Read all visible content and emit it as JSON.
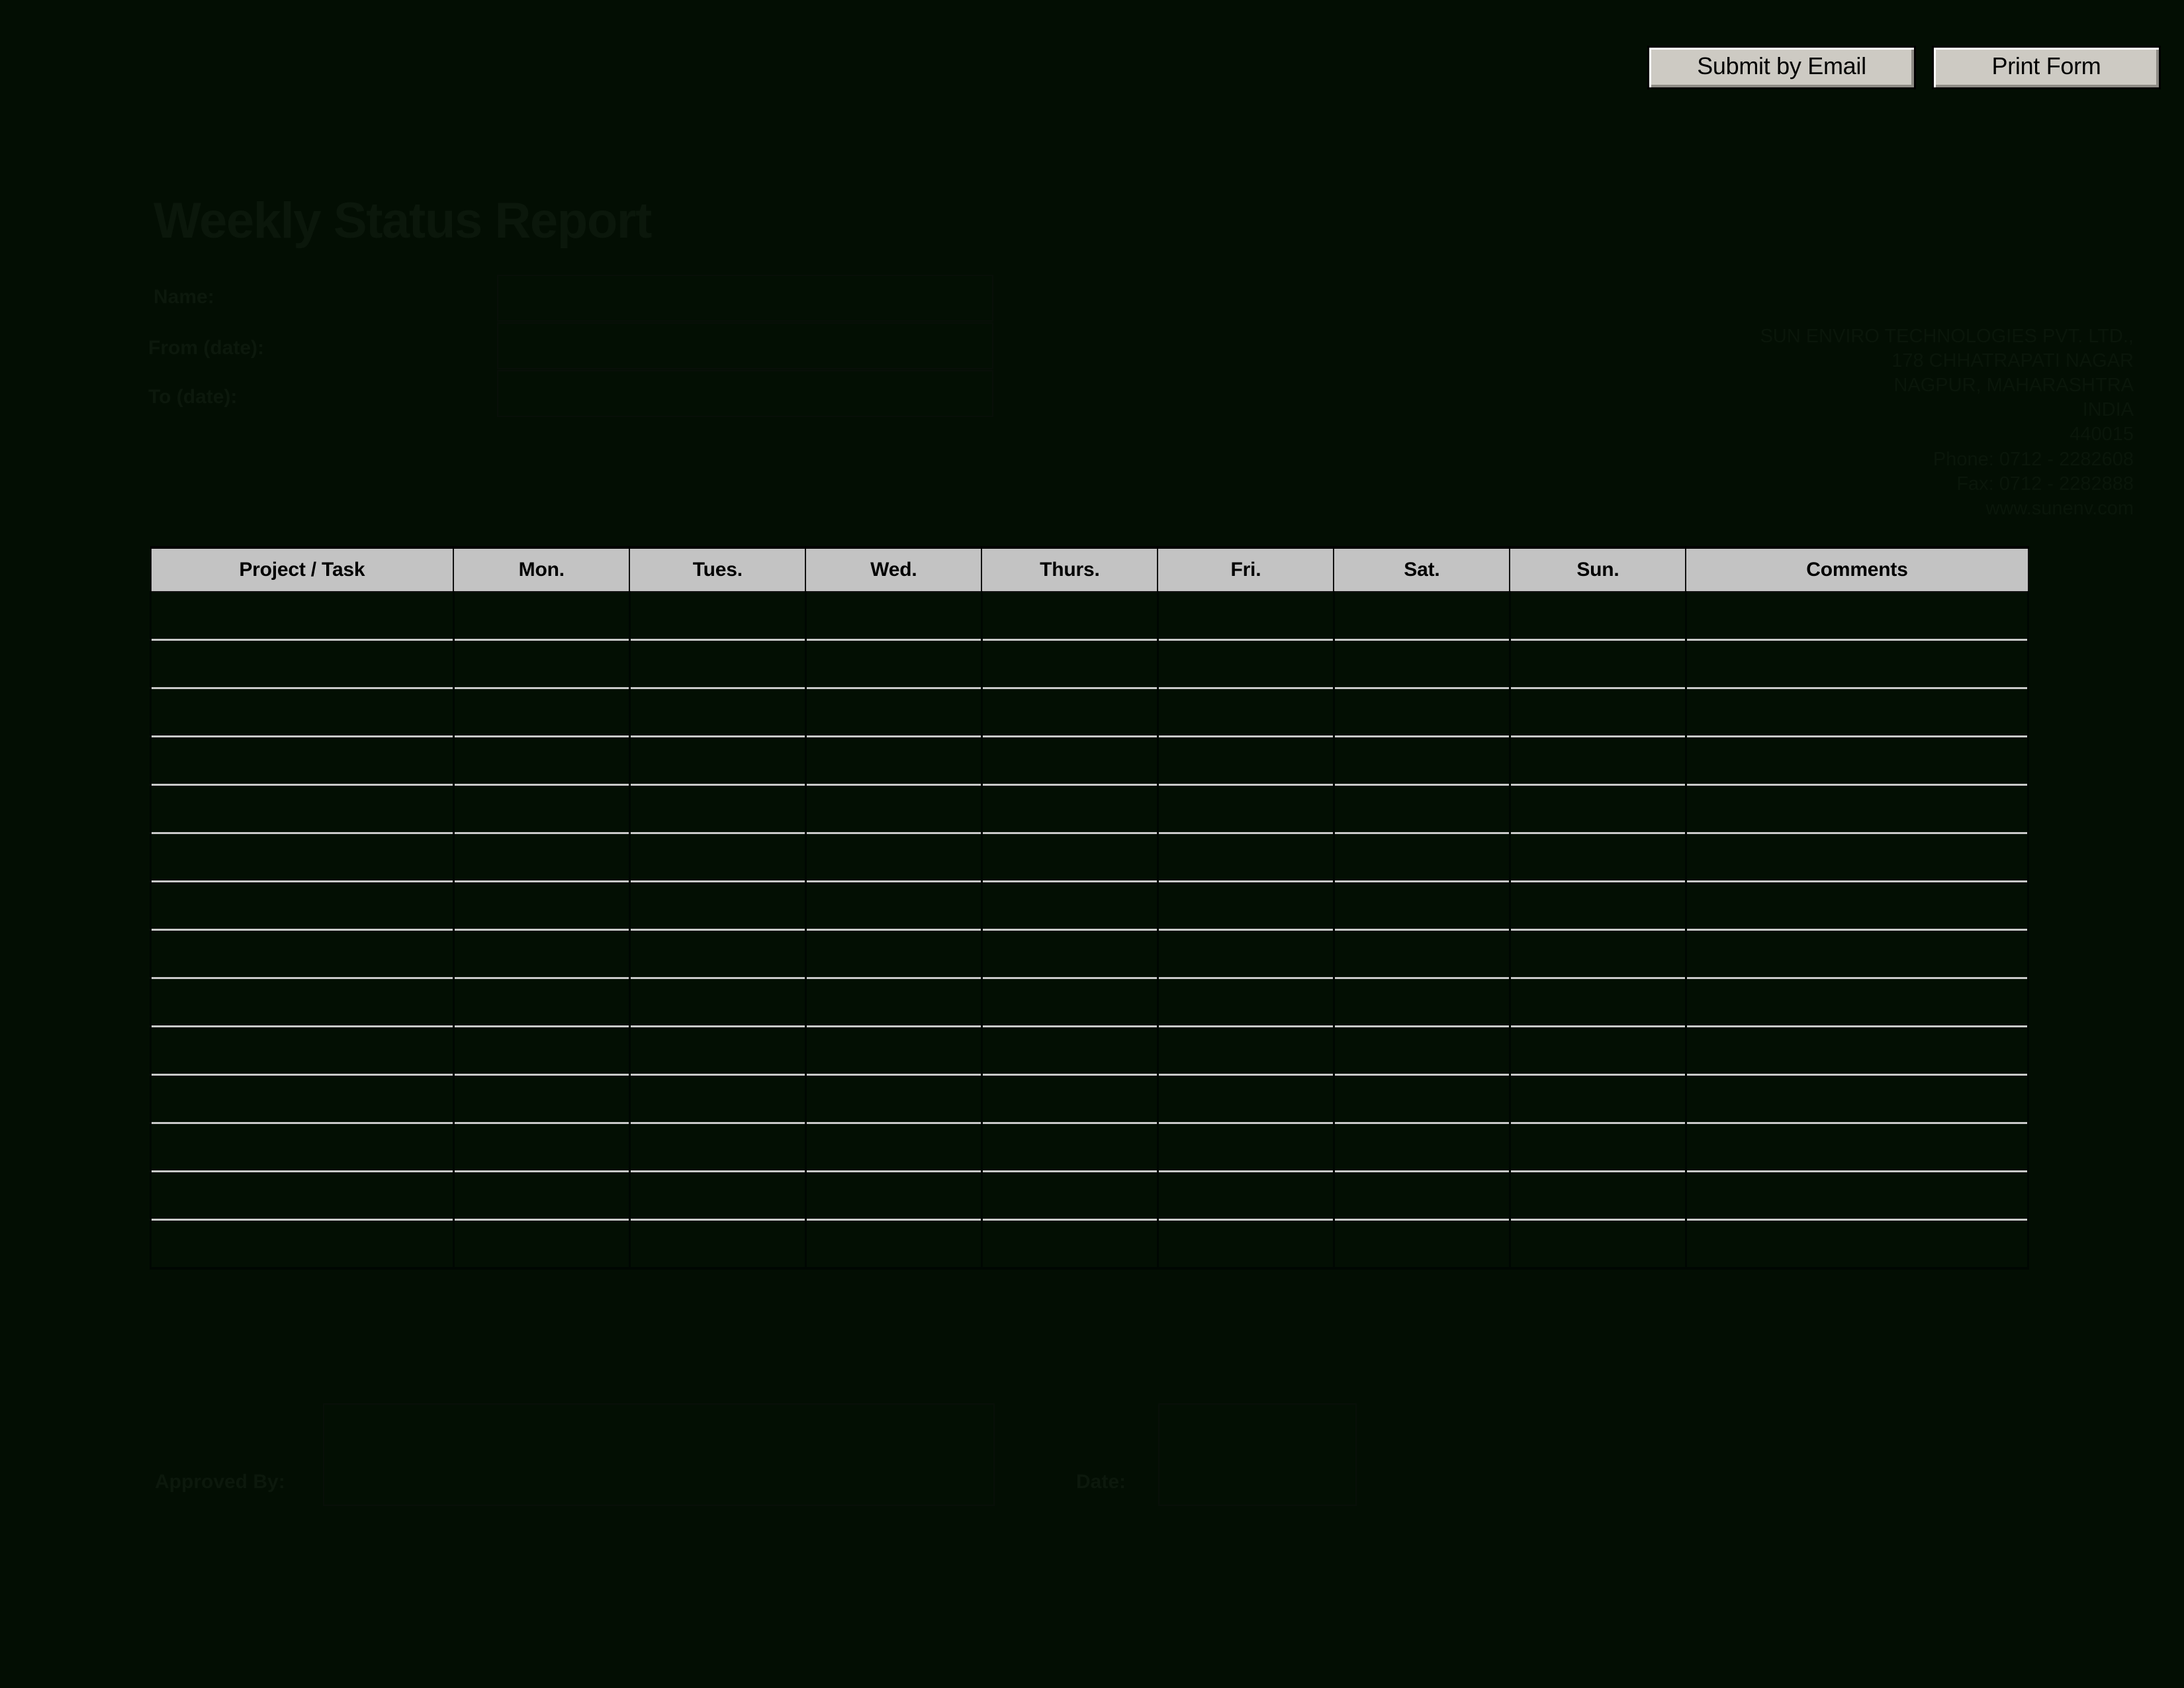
{
  "toolbar": {
    "submit_by_email_label": "Submit by Email",
    "print_form_label": "Print Form"
  },
  "document": {
    "title": "Weekly Status Report"
  },
  "form_fields": {
    "name_label": "Name:",
    "name_value": "",
    "name_placeholder": "",
    "from_date_label": "From (date):",
    "from_date_value": "",
    "from_date_placeholder": "",
    "to_date_label": "To (date):",
    "to_date_value": "",
    "to_date_placeholder": ""
  },
  "company": {
    "address_lines": [
      "SUN ENVIRO TECHNOLOGIES PVT. LTD.,",
      "178 CHHATRAPATI NAGAR",
      "NAGPUR, MAHARASHTRA",
      "INDIA",
      "440015",
      "Phone: 0712 - 2282608",
      "Fax: 0712 - 2282888",
      "www.sunenv.com"
    ]
  },
  "table": {
    "headers": [
      "Project / Task",
      "Mon.",
      "Tues.",
      "Wed.",
      "Thurs.",
      "Fri.",
      "Sat.",
      "Sun.",
      "Comments"
    ],
    "row_count": 14,
    "rows": [
      [
        "",
        "",
        "",
        "",
        "",
        "",
        "",
        "",
        ""
      ],
      [
        "",
        "",
        "",
        "",
        "",
        "",
        "",
        "",
        ""
      ],
      [
        "",
        "",
        "",
        "",
        "",
        "",
        "",
        "",
        ""
      ],
      [
        "",
        "",
        "",
        "",
        "",
        "",
        "",
        "",
        ""
      ],
      [
        "",
        "",
        "",
        "",
        "",
        "",
        "",
        "",
        ""
      ],
      [
        "",
        "",
        "",
        "",
        "",
        "",
        "",
        "",
        ""
      ],
      [
        "",
        "",
        "",
        "",
        "",
        "",
        "",
        "",
        ""
      ],
      [
        "",
        "",
        "",
        "",
        "",
        "",
        "",
        "",
        ""
      ],
      [
        "",
        "",
        "",
        "",
        "",
        "",
        "",
        "",
        ""
      ],
      [
        "",
        "",
        "",
        "",
        "",
        "",
        "",
        "",
        ""
      ],
      [
        "",
        "",
        "",
        "",
        "",
        "",
        "",
        "",
        ""
      ],
      [
        "",
        "",
        "",
        "",
        "",
        "",
        "",
        "",
        ""
      ],
      [
        "",
        "",
        "",
        "",
        "",
        "",
        "",
        "",
        ""
      ],
      [
        "",
        "",
        "",
        "",
        "",
        "",
        "",
        "",
        ""
      ]
    ]
  },
  "approval": {
    "approved_by_label": "Approved By:",
    "approved_by_value": "",
    "approved_by_placeholder": "",
    "date_label": "Date:",
    "date_value": "",
    "date_placeholder": ""
  },
  "colors": {
    "page_background": "#030e03",
    "header_fill": "#c3c3c3",
    "button_face": "#cdcac3",
    "text_dark": "#0b170b",
    "row_separator": "#c9c9c9"
  }
}
